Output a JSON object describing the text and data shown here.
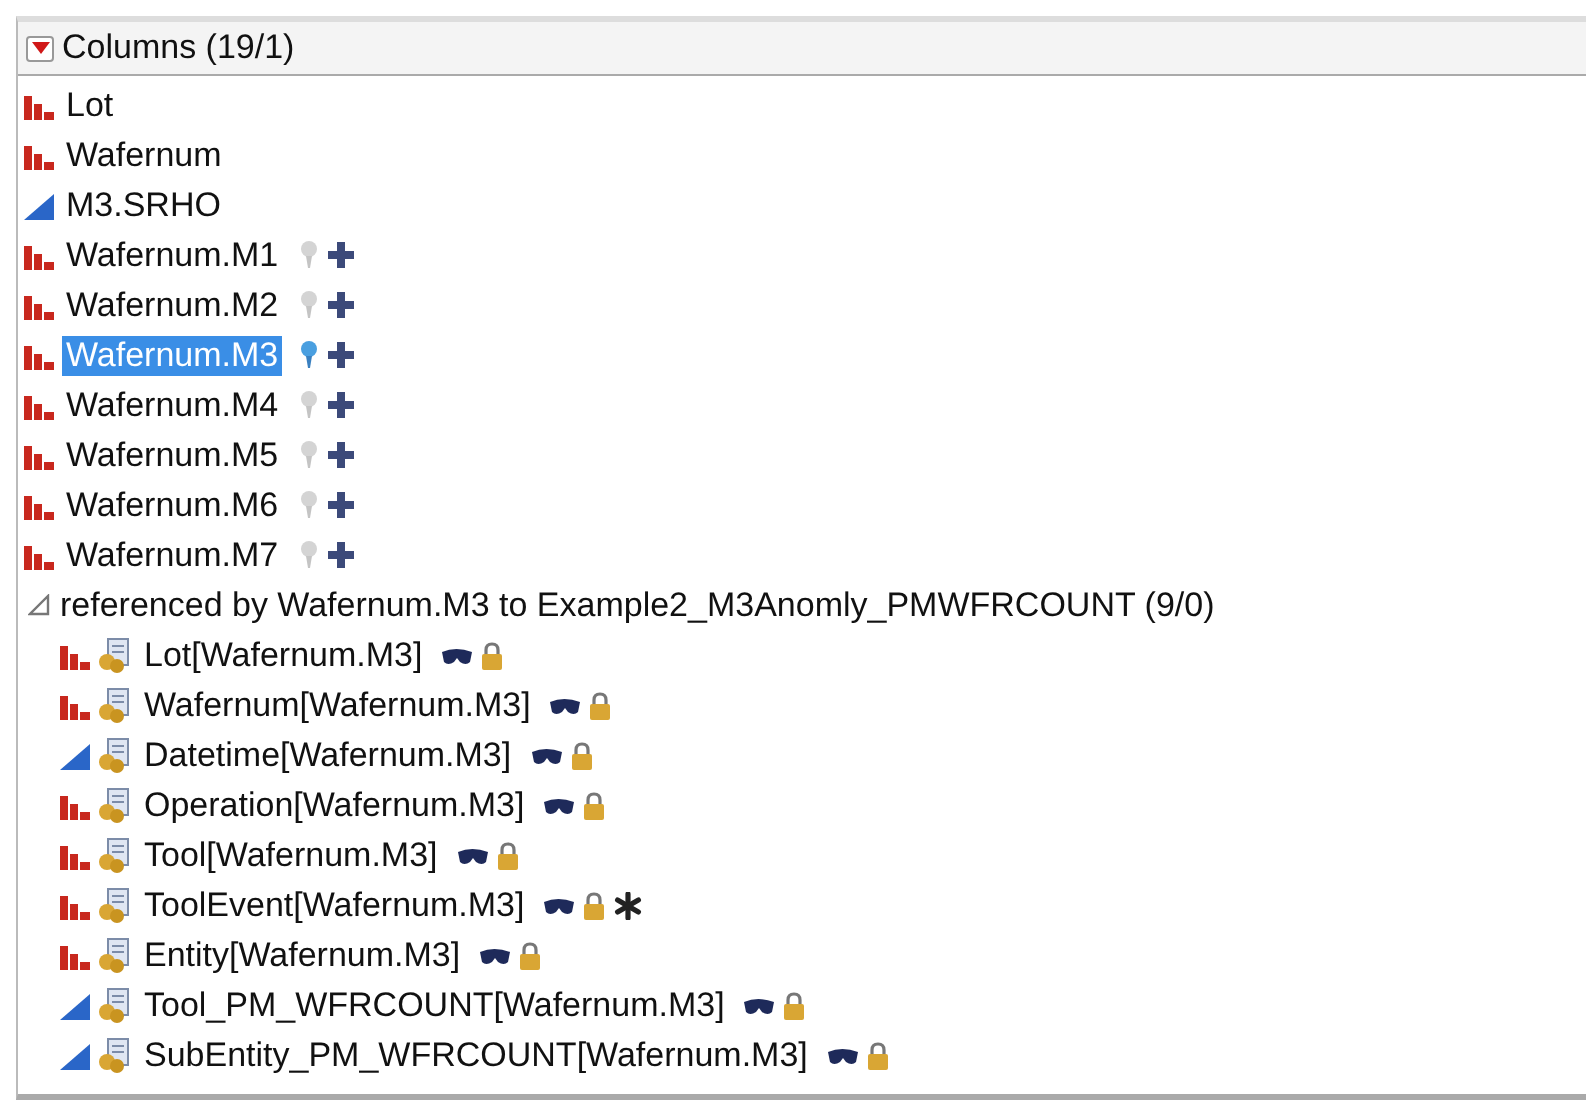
{
  "panel": {
    "title": "Columns (19/1)",
    "expanded": true
  },
  "columns": [
    {
      "name": "Lot",
      "kind": "nominal",
      "selected": false
    },
    {
      "name": "Wafernum",
      "kind": "nominal",
      "selected": false
    },
    {
      "name": "M3.SRHO",
      "kind": "continuous",
      "selected": false
    },
    {
      "name": "Wafernum.M1",
      "kind": "nominal",
      "selected": false,
      "link_active": false
    },
    {
      "name": "Wafernum.M2",
      "kind": "nominal",
      "selected": false,
      "link_active": false
    },
    {
      "name": "Wafernum.M3",
      "kind": "nominal",
      "selected": true,
      "link_active": true
    },
    {
      "name": "Wafernum.M4",
      "kind": "nominal",
      "selected": false,
      "link_active": false
    },
    {
      "name": "Wafernum.M5",
      "kind": "nominal",
      "selected": false,
      "link_active": false
    },
    {
      "name": "Wafernum.M6",
      "kind": "nominal",
      "selected": false,
      "link_active": false
    },
    {
      "name": "Wafernum.M7",
      "kind": "nominal",
      "selected": false,
      "link_active": false
    }
  ],
  "reference_group": {
    "label": "referenced by Wafernum.M3 to Example2_M3Anomly_PMWFRCOUNT (9/0)",
    "expanded": true,
    "children": [
      {
        "name": "Lot[Wafernum.M3]",
        "kind": "nominal",
        "markers": [
          {
            "kind": "hidden"
          },
          {
            "kind": "locked"
          }
        ]
      },
      {
        "name": "Wafernum[Wafernum.M3]",
        "kind": "nominal",
        "markers": [
          {
            "kind": "hidden"
          },
          {
            "kind": "locked"
          }
        ]
      },
      {
        "name": "Datetime[Wafernum.M3]",
        "kind": "continuous",
        "markers": [
          {
            "kind": "hidden"
          },
          {
            "kind": "locked"
          }
        ]
      },
      {
        "name": "Operation[Wafernum.M3]",
        "kind": "nominal",
        "markers": [
          {
            "kind": "hidden"
          },
          {
            "kind": "locked"
          }
        ]
      },
      {
        "name": "Tool[Wafernum.M3]",
        "kind": "nominal",
        "markers": [
          {
            "kind": "hidden"
          },
          {
            "kind": "locked"
          }
        ]
      },
      {
        "name": "ToolEvent[Wafernum.M3]",
        "kind": "nominal",
        "markers": [
          {
            "kind": "hidden"
          },
          {
            "kind": "locked"
          },
          {
            "kind": "formula"
          }
        ]
      },
      {
        "name": "Entity[Wafernum.M3]",
        "kind": "nominal",
        "markers": [
          {
            "kind": "hidden"
          },
          {
            "kind": "locked"
          }
        ]
      },
      {
        "name": "Tool_PM_WFRCOUNT[Wafernum.M3]",
        "kind": "continuous",
        "markers": [
          {
            "kind": "hidden"
          },
          {
            "kind": "locked"
          }
        ]
      },
      {
        "name": "SubEntity_PM_WFRCOUNT[Wafernum.M3]",
        "kind": "continuous",
        "markers": [
          {
            "kind": "hidden"
          },
          {
            "kind": "locked"
          }
        ]
      }
    ]
  }
}
